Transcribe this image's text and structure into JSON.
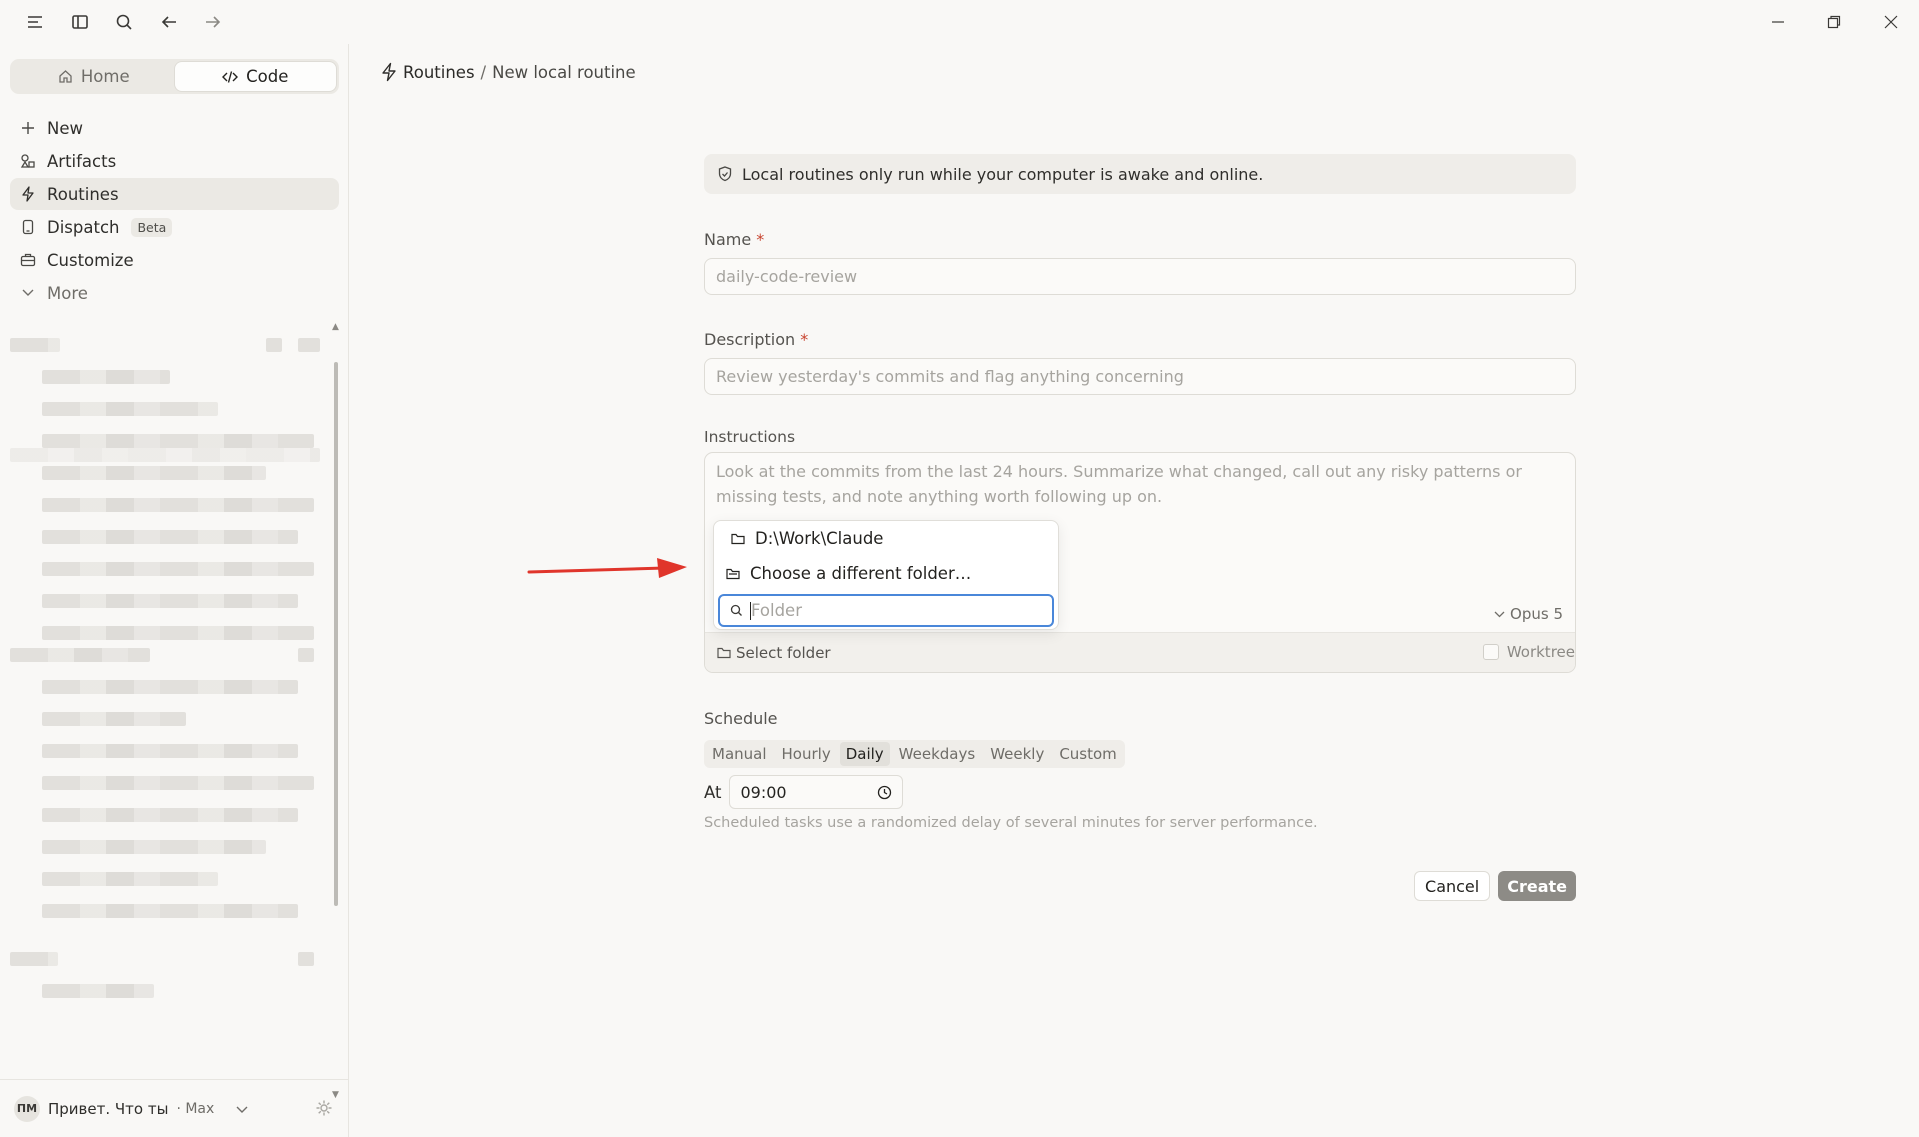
{
  "sidebar": {
    "mode_tabs": [
      {
        "label": "Home",
        "icon": "home-icon",
        "active": false
      },
      {
        "label": "Code",
        "icon": "code-icon",
        "active": true
      }
    ],
    "nav": [
      {
        "label": "New",
        "icon": "plus-icon"
      },
      {
        "label": "Artifacts",
        "icon": "artifacts-icon"
      },
      {
        "label": "Routines",
        "icon": "routine-icon",
        "active": true
      },
      {
        "label": "Dispatch",
        "icon": "dispatch-icon",
        "badge": "Beta"
      },
      {
        "label": "Customize",
        "icon": "briefcase-icon"
      },
      {
        "label": "More",
        "icon": "chevron-down-icon"
      }
    ],
    "user": {
      "initials": "ПМ",
      "name": "Привет. Что ты",
      "plan": "· Max"
    }
  },
  "breadcrumb": {
    "parent": "Routines",
    "separator": "/",
    "current": "New local routine"
  },
  "form": {
    "notice": "Local routines only run while your computer is awake and online.",
    "name": {
      "label": "Name",
      "required_mark": "*",
      "placeholder": "daily-code-review"
    },
    "description": {
      "label": "Description",
      "required_mark": "*",
      "placeholder": "Review yesterday's commits and flag anything concerning"
    },
    "instructions": {
      "label": "Instructions",
      "placeholder": "Look at the commits from the last 24 hours. Summarize what changed, call out any risky patterns or missing tests, and note anything worth following up on.",
      "model": "Opus 5",
      "select_folder": "Select folder",
      "worktree": "Worktree"
    },
    "folder_dropdown": {
      "recent_folder": "D:\\Work\\Claude",
      "choose_other": "Choose a different folder…",
      "search_placeholder": "Folder"
    },
    "schedule": {
      "label": "Schedule",
      "options": [
        "Manual",
        "Hourly",
        "Daily",
        "Weekdays",
        "Weekly",
        "Custom"
      ],
      "selected": "Daily",
      "at_label": "At",
      "time": "09:00",
      "hint": "Scheduled tasks use a randomized delay of several minutes for server performance."
    },
    "cancel_label": "Cancel",
    "create_label": "Create"
  },
  "colors": {
    "background": "#f9f8f6",
    "sidebar_active": "#ebe9e4",
    "required": "#c8432e",
    "focus_ring": "#4a87d9",
    "annotation_arrow": "#e0352b",
    "create_button": "#8d8b86"
  }
}
